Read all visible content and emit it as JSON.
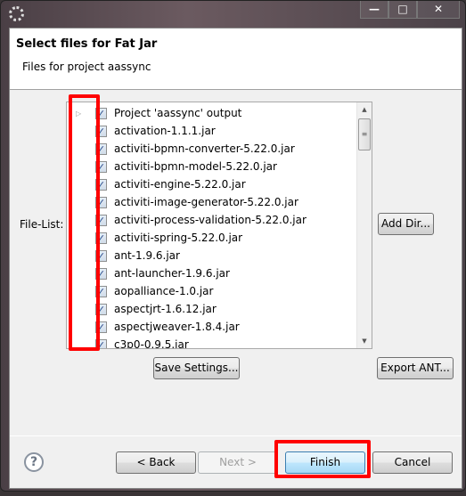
{
  "window": {
    "minimize": "—",
    "maximize": "□",
    "close": "✕",
    "app_icon": "eclipse-gear-icon"
  },
  "header": {
    "title": "Select files for Fat Jar",
    "subtitle": "Files for project aassync"
  },
  "file_list": {
    "label": "File-List:",
    "items": [
      {
        "label": "Project 'aassync' output",
        "checked": true,
        "expandable": true
      },
      {
        "label": "activation-1.1.1.jar",
        "checked": true
      },
      {
        "label": "activiti-bpmn-converter-5.22.0.jar",
        "checked": true
      },
      {
        "label": "activiti-bpmn-model-5.22.0.jar",
        "checked": true
      },
      {
        "label": "activiti-engine-5.22.0.jar",
        "checked": true
      },
      {
        "label": "activiti-image-generator-5.22.0.jar",
        "checked": true
      },
      {
        "label": "activiti-process-validation-5.22.0.jar",
        "checked": true
      },
      {
        "label": "activiti-spring-5.22.0.jar",
        "checked": true
      },
      {
        "label": "ant-1.9.6.jar",
        "checked": true
      },
      {
        "label": "ant-launcher-1.9.6.jar",
        "checked": true
      },
      {
        "label": "aopalliance-1.0.jar",
        "checked": true
      },
      {
        "label": "aspectjrt-1.6.12.jar",
        "checked": true
      },
      {
        "label": "aspectjweaver-1.8.4.jar",
        "checked": true
      },
      {
        "label": "c3p0-0.9.5.jar",
        "checked": true
      }
    ]
  },
  "buttons": {
    "add_dir": "Add Dir...",
    "save_settings": "Save Settings...",
    "export_ant": "Export ANT...",
    "back": "< Back",
    "next": "Next >",
    "finish": "Finish",
    "cancel": "Cancel",
    "help": "?"
  },
  "highlight_color": "#ff0000"
}
